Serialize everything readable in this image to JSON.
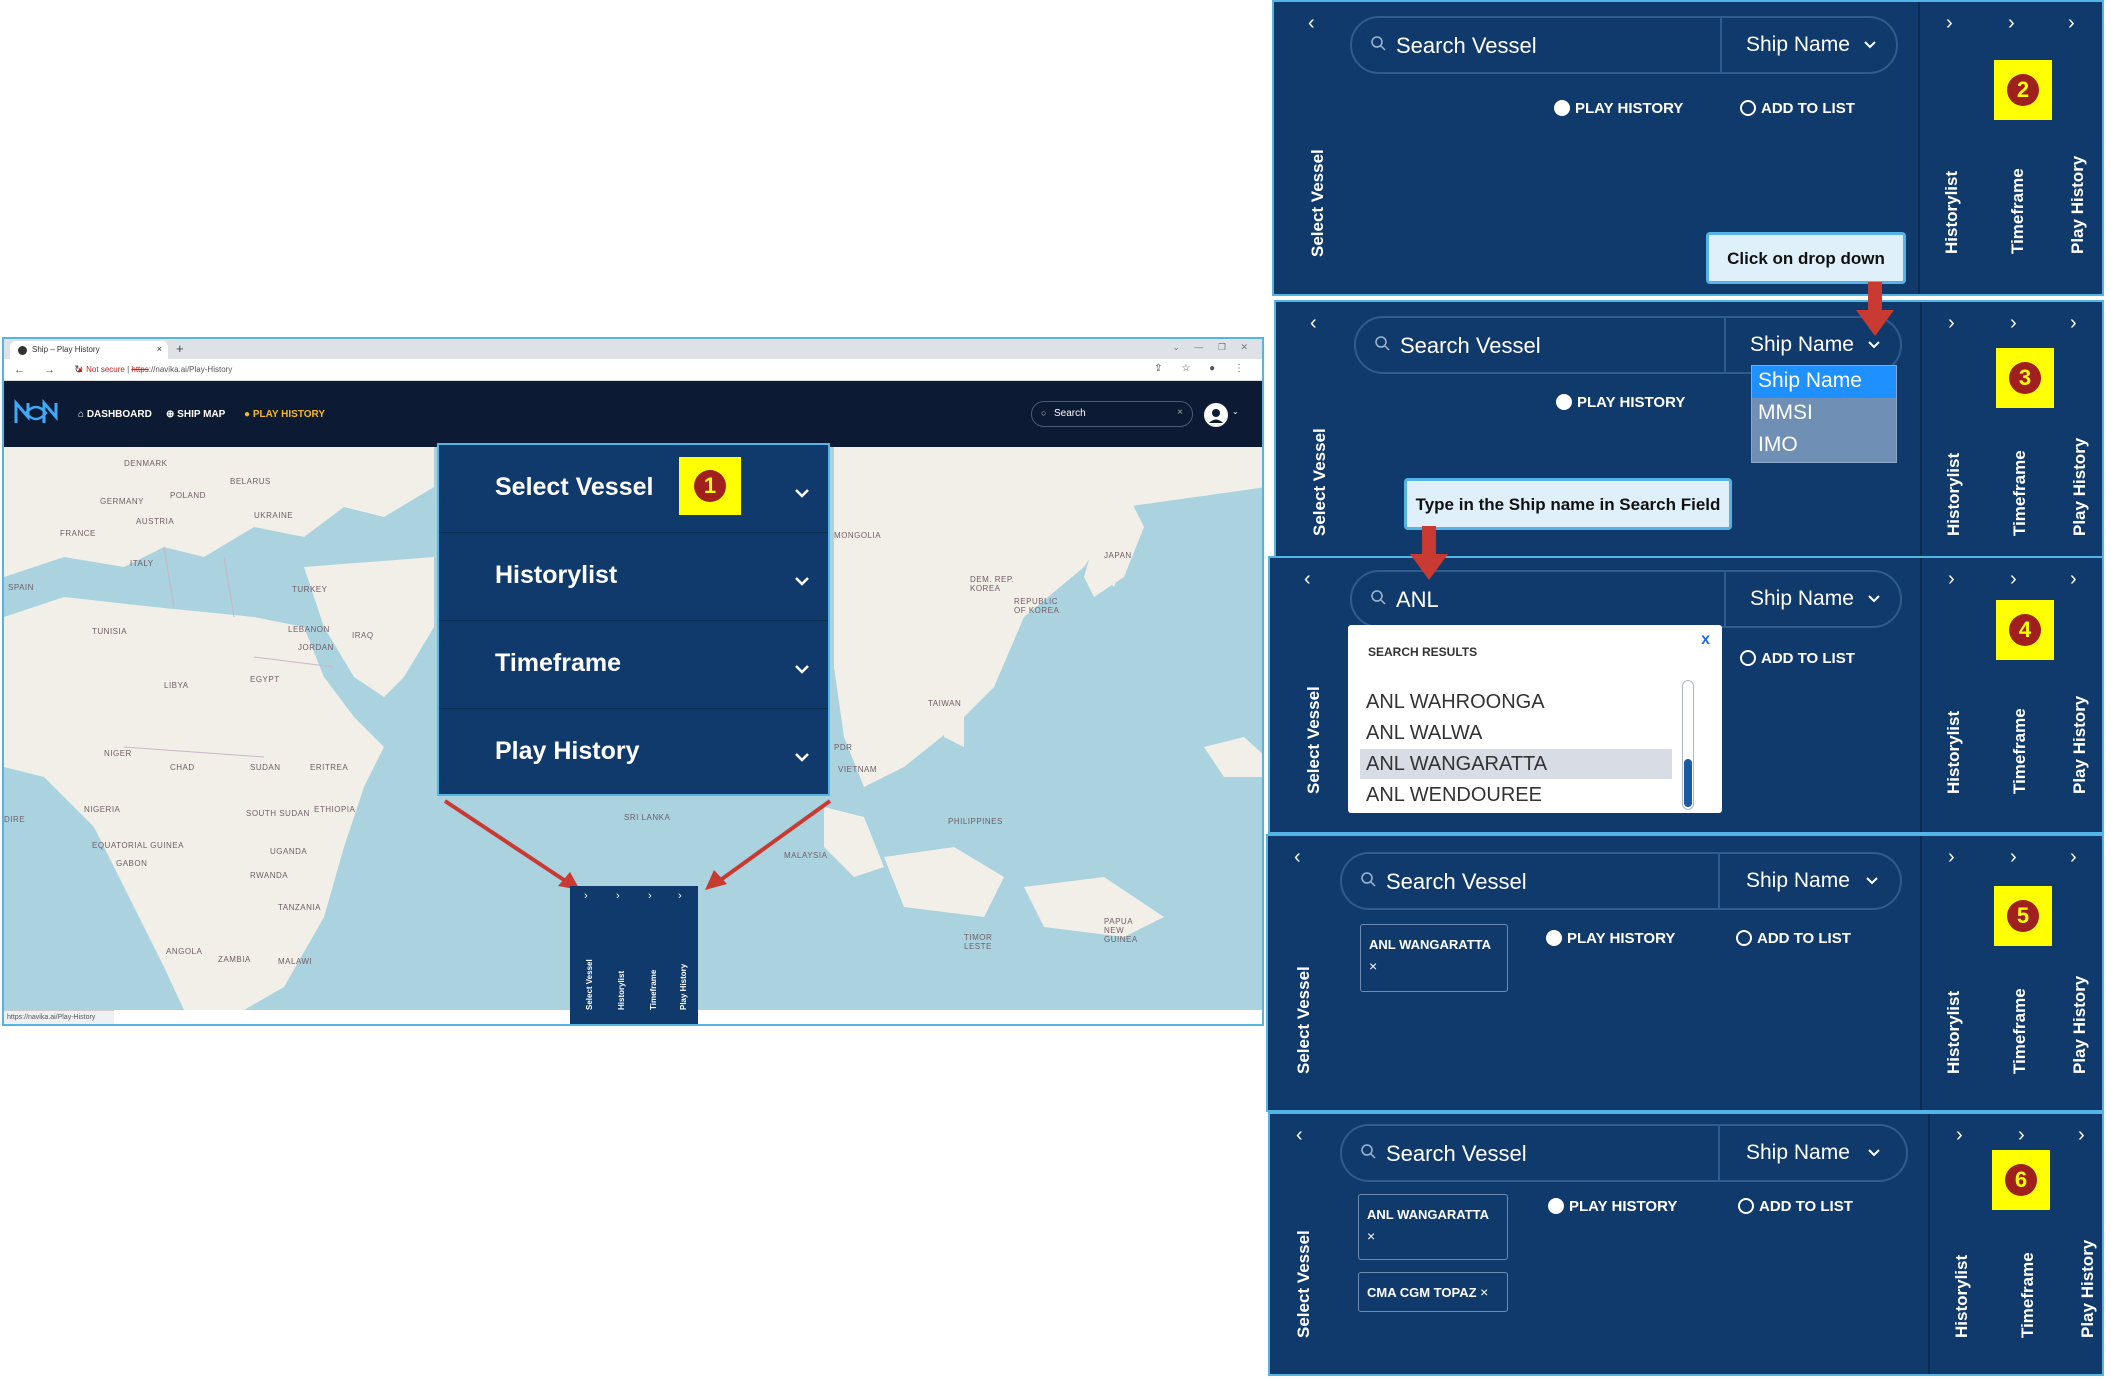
{
  "browser": {
    "tab_title": "Ship – Play History",
    "tab_close": "×",
    "new_tab": "+",
    "window_controls": "⌄ — ❐ ✕",
    "nav_buttons": "← → ↻",
    "url_warning": "▲ Not secure",
    "url_scheme": "https",
    "url_rest": "://navika.ai/Play-History",
    "addr_right": "⇪ ☆ ● ⋮",
    "status_url": "https://navika.ai/Play-History"
  },
  "app": {
    "nav": {
      "dashboard": "DASHBOARD",
      "ship_map": "SHIP MAP",
      "play_history": "PLAY HISTORY"
    },
    "search_placeholder": "Search",
    "search_clear": "×",
    "avatar_caret": "⌄"
  },
  "map": {
    "countries": [
      "DENMARK",
      "BELARUS",
      "POLAND",
      "GERMANY",
      "UKRAINE",
      "AUSTRIA",
      "FRANCE",
      "ITALY",
      "SPAIN",
      "TURKEY",
      "TUNISIA",
      "LEBANON",
      "IRAQ",
      "JORDAN",
      "LIBYA",
      "EGYPT",
      "NIGER",
      "CHAD",
      "SUDAN",
      "ERITREA",
      "ETHIOPIA",
      "NIGERIA",
      "SOUTH SUDAN",
      "EQUATORIAL GUINEA",
      "GABON",
      "UGANDA",
      "RWANDA",
      "TANZANIA",
      "ANGOLA",
      "ZAMBIA",
      "MALAWI",
      "MONGOLIA",
      "JAPAN",
      "DEM. REP. KOREA",
      "REPUBLIC OF KOREA",
      "TAIWAN",
      "PDR",
      "VIETNAM",
      "SRI LANKA",
      "MALAYSIA",
      "PHILIPPINES",
      "PAPUA NEW GUINEA",
      "TIMOR LESTE",
      "DIRE"
    ]
  },
  "accordion": {
    "items": [
      "Select Vessel",
      "Historylist",
      "Timeframe",
      "Play History"
    ],
    "badge": "1"
  },
  "mini_panel": {
    "chevron": "›",
    "labels": [
      "Select Vessel",
      "Historylist",
      "Timeframe",
      "Play History"
    ]
  },
  "steps": {
    "search_placeholder": "Search Vessel",
    "select_value": "Ship Name",
    "select_vessel_label": "Select Vessel",
    "historylist_label": "Historylist",
    "timeframe_label": "Timeframe",
    "play_history_label": "Play History",
    "back_chevron": "‹",
    "forward_chevron": "›",
    "action_play": "PLAY HISTORY",
    "action_add": "ADD TO LIST",
    "badges": [
      "2",
      "3",
      "4",
      "5",
      "6"
    ],
    "step4_query": "ANL",
    "dropdown_options": [
      "Ship Name",
      "MMSI",
      "IMO"
    ],
    "results": {
      "header": "SEARCH RESULTS",
      "close": "x",
      "items": [
        "ANL WAHROONGA",
        "ANL WALWA",
        "ANL WANGARATTA",
        "ANL WENDOUREE"
      ]
    },
    "chip_1": "ANL WANGARATTA",
    "chip_2": "CMA CGM TOPAZ",
    "chip_x": "×"
  },
  "callouts": {
    "dropdown": "Click on drop down",
    "type_name": "Type in the Ship name in Search Field"
  },
  "colors": {
    "panel_bg": "#103a6b",
    "app_bar": "#0c1a33",
    "accent_border": "#55b4e6",
    "active_nav": "#f5b82e",
    "badge_bg": "#ffff00",
    "badge_num": "#a02020",
    "arrow": "#c83a32",
    "selected_option": "#1e90ff"
  }
}
